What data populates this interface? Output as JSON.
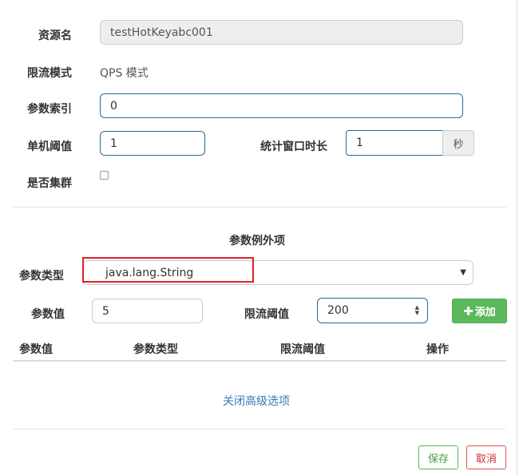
{
  "form": {
    "resource_label": "资源名",
    "resource_value": "testHotKeyabc001",
    "mode_label": "限流模式",
    "mode_value": "QPS 模式",
    "param_index_label": "参数索引",
    "param_index_value": "0",
    "threshold_label": "单机阈值",
    "threshold_value": "1",
    "window_label": "统计窗口时长",
    "window_value": "1",
    "window_unit": "秒",
    "cluster_label": "是否集群",
    "cluster_checked": false
  },
  "exception": {
    "section_title": "参数例外项",
    "type_label": "参数类型",
    "type_value": "java.lang.String",
    "value_label": "参数值",
    "value_value": "5",
    "limit_label": "限流阈值",
    "limit_value": "200",
    "add_label": "添加",
    "table_headers": [
      "参数值",
      "参数类型",
      "限流阈值",
      "操作"
    ]
  },
  "advanced_link": "关闭高级选项",
  "footer": {
    "save_label": "保存",
    "cancel_label": "取消"
  },
  "colors": {
    "input_border": "#1f6c99",
    "success": "#5cb85c",
    "danger": "#d9534f",
    "link": "#337ab7",
    "highlight": "#d9232e"
  }
}
